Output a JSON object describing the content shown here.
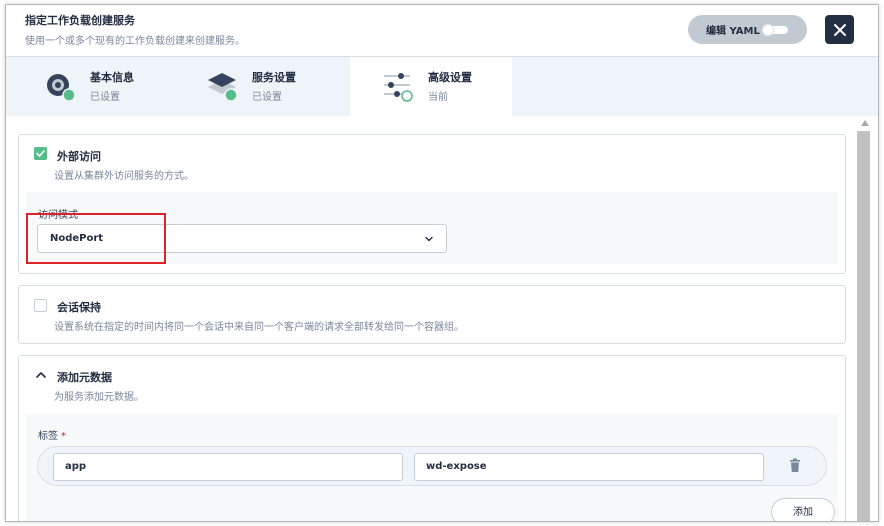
{
  "header": {
    "title": "指定工作负载创建服务",
    "subtitle": "使用一个或多个现有的工作负载创建来创建服务。",
    "yaml_label": "编辑 YAML"
  },
  "tabs": [
    {
      "name": "基本信息",
      "status": "已设置",
      "icon": "basic-info-icon",
      "active": false
    },
    {
      "name": "服务设置",
      "status": "已设置",
      "icon": "service-settings-icon",
      "active": false
    },
    {
      "name": "高级设置",
      "status": "当前",
      "icon": "advanced-settings-icon",
      "active": true
    }
  ],
  "external_access": {
    "title": "外部访问",
    "description": "设置从集群外访问服务的方式。",
    "checked": true,
    "access_mode_label": "访问模式",
    "access_mode_value": "NodePort"
  },
  "session_affinity": {
    "title": "会话保持",
    "description": "设置系统在指定的时间内将同一个会话中来自同一个客户端的请求全部转发给同一个容器组。",
    "checked": false
  },
  "metadata": {
    "title": "添加元数据",
    "description": "为服务添加元数据。",
    "labels_title": "标签",
    "required_mark": "*",
    "label_key": "app",
    "label_value": "wd-expose",
    "add_label": "添加"
  },
  "colors": {
    "accent_green": "#55bc8a",
    "dark": "#242e42",
    "highlight_red": "#d9242d"
  }
}
